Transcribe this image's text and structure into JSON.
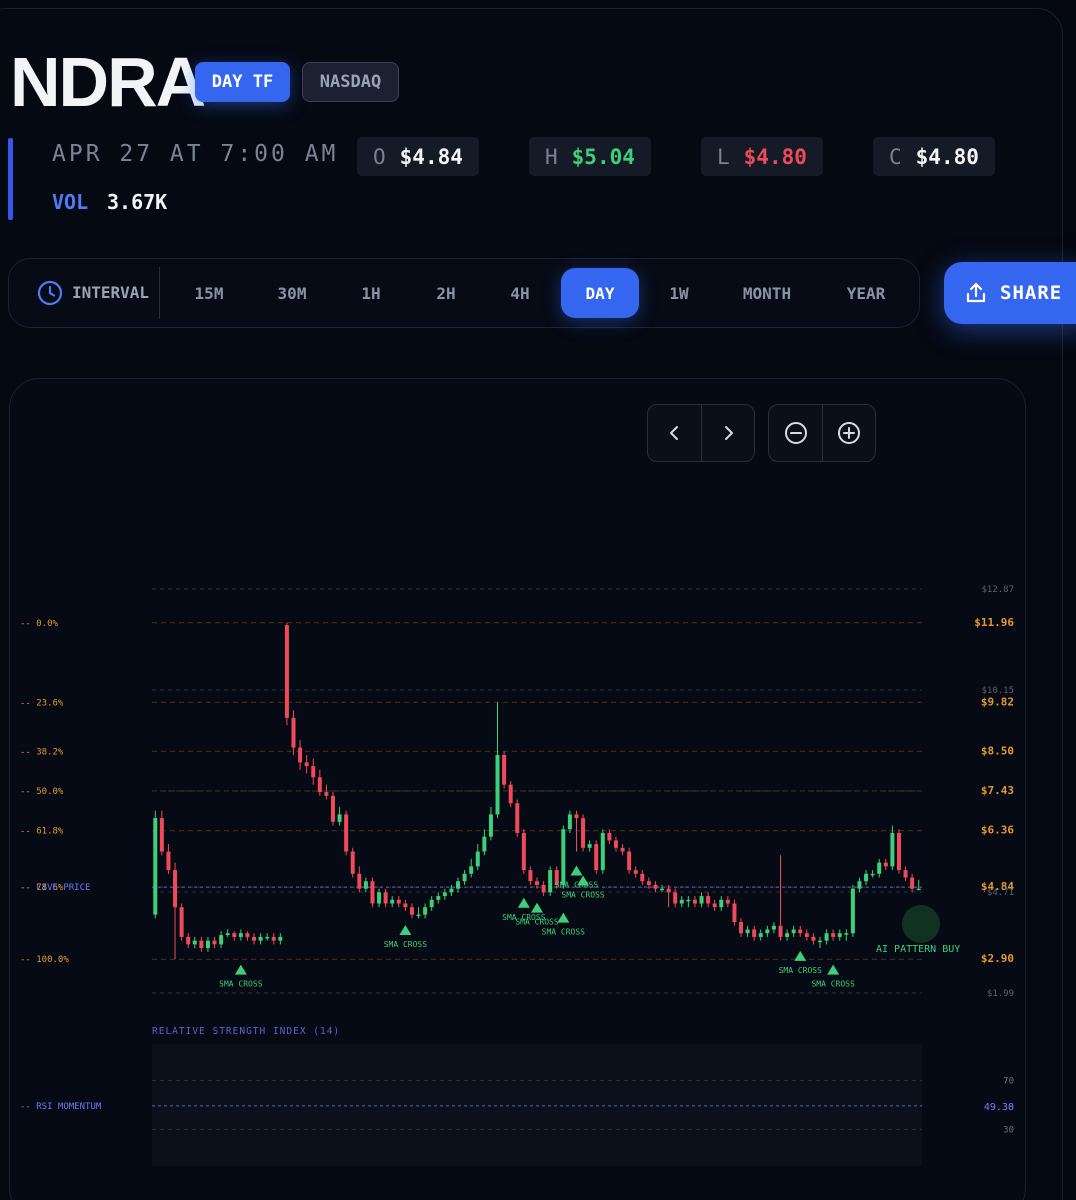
{
  "ticker": "NDRA",
  "badges": {
    "timeframe": "DAY TF",
    "exchange": "NASDAQ"
  },
  "info": {
    "date": "APR 27 AT 7:00 AM",
    "ohlc": [
      {
        "key": "O",
        "value": "$4.84",
        "color": "#f3f4f7"
      },
      {
        "key": "H",
        "value": "$5.04",
        "color": "#3ecf7b"
      },
      {
        "key": "L",
        "value": "$4.80",
        "color": "#ef4a5a"
      },
      {
        "key": "C",
        "value": "$4.80",
        "color": "#f3f4f7"
      }
    ],
    "vol_label": "VOL",
    "vol_value": "3.67K"
  },
  "interval": {
    "label": "INTERVAL",
    "options": [
      "15M",
      "30M",
      "1H",
      "2H",
      "4H",
      "DAY",
      "1W",
      "MONTH",
      "YEAR"
    ],
    "active": "DAY"
  },
  "share_label": "SHARE",
  "icons": [
    "clock-icon",
    "share-icon",
    "chevron-left-icon",
    "chevron-right-icon",
    "zoom-out-icon",
    "zoom-in-icon"
  ],
  "colors": {
    "accent": "#3466f0",
    "up": "#3ecf7b",
    "down": "#ef4a5a",
    "fib": "#e39a2a"
  },
  "chart_data": {
    "type": "candlestick",
    "price_axis_labels": [
      "$12.87",
      "$11.96",
      "$10.15",
      "$9.82",
      "$8.50",
      "$7.43",
      "$6.36",
      "$4.84",
      "$4.71",
      "$2.90",
      "$1.99"
    ],
    "price_grid": [
      12.87,
      10.15,
      7.43,
      4.71,
      1.99
    ],
    "fib_levels": [
      {
        "label": "0.0%",
        "price": 11.96,
        "price_label": "$11.96"
      },
      {
        "label": "23.6%",
        "price": 9.82,
        "price_label": "$9.82"
      },
      {
        "label": "38.2%",
        "price": 8.5,
        "price_label": "$8.50"
      },
      {
        "label": "50.0%",
        "price": 7.43,
        "price_label": "$7.43"
      },
      {
        "label": "61.8%",
        "price": 6.36,
        "price_label": "$6.36"
      },
      {
        "label": "78.6%",
        "price": 4.84,
        "price_label": "$4.84"
      },
      {
        "label": "100.0%",
        "price": 2.9,
        "price_label": "$2.90"
      }
    ],
    "live_price": {
      "label": "LIVE PRICE",
      "price": 4.84
    },
    "ylim": [
      1.99,
      12.87
    ],
    "candles": {
      "open": [
        4.1,
        6.7,
        5.8,
        5.3,
        4.3,
        3.5,
        3.3,
        3.4,
        3.2,
        3.4,
        3.3,
        3.55,
        3.6,
        3.5,
        3.6,
        3.5,
        3.4,
        3.5,
        3.5,
        3.4,
        11.9,
        9.4,
        8.6,
        8.2,
        8.1,
        7.8,
        7.4,
        7.3,
        6.6,
        6.8,
        5.8,
        5.2,
        4.8,
        5.0,
        4.4,
        4.7,
        4.4,
        4.5,
        4.4,
        4.3,
        4.1,
        4.1,
        4.3,
        4.5,
        4.6,
        4.7,
        4.8,
        5.0,
        5.2,
        5.4,
        5.8,
        6.2,
        6.8,
        8.4,
        7.6,
        7.1,
        6.3,
        5.3,
        5.0,
        4.9,
        4.7,
        5.3,
        4.9,
        6.4,
        6.8,
        6.7,
        5.9,
        6.0,
        5.3,
        6.3,
        6.1,
        5.9,
        5.8,
        5.3,
        5.2,
        5.0,
        4.9,
        4.8,
        4.8,
        4.7,
        4.4,
        4.5,
        4.5,
        4.4,
        4.6,
        4.4,
        4.3,
        4.5,
        4.4,
        3.9,
        3.6,
        3.7,
        3.5,
        3.6,
        3.7,
        3.8,
        3.5,
        3.6,
        3.7,
        3.6,
        3.5,
        3.4,
        3.4,
        3.6,
        3.5,
        3.6,
        3.6,
        4.8,
        5.0,
        5.2,
        5.2,
        5.5,
        5.4,
        6.3,
        5.3,
        5.1,
        4.8
      ],
      "close": [
        6.7,
        5.8,
        5.3,
        4.3,
        3.5,
        3.3,
        3.4,
        3.2,
        3.4,
        3.3,
        3.55,
        3.6,
        3.5,
        3.6,
        3.5,
        3.4,
        3.5,
        3.5,
        3.4,
        3.5,
        9.4,
        8.6,
        8.2,
        8.1,
        7.8,
        7.4,
        7.3,
        6.6,
        6.8,
        5.8,
        5.2,
        4.8,
        5.0,
        4.4,
        4.7,
        4.4,
        4.5,
        4.4,
        4.3,
        4.1,
        4.1,
        4.3,
        4.5,
        4.6,
        4.7,
        4.8,
        5.0,
        5.2,
        5.4,
        5.8,
        6.2,
        6.8,
        8.4,
        7.6,
        7.1,
        6.3,
        5.3,
        5.0,
        4.9,
        4.7,
        5.3,
        4.9,
        6.4,
        6.8,
        6.7,
        5.9,
        6.0,
        5.3,
        6.3,
        6.1,
        5.9,
        5.8,
        5.3,
        5.2,
        5.0,
        4.9,
        4.8,
        4.8,
        4.7,
        4.4,
        4.5,
        4.5,
        4.4,
        4.6,
        4.4,
        4.3,
        4.5,
        4.4,
        3.9,
        3.6,
        3.7,
        3.5,
        3.6,
        3.7,
        3.8,
        3.5,
        3.6,
        3.7,
        3.6,
        3.5,
        3.4,
        3.4,
        3.6,
        3.5,
        3.6,
        3.6,
        4.8,
        5.0,
        5.2,
        5.2,
        5.5,
        5.4,
        6.3,
        5.3,
        5.1,
        4.8,
        4.8
      ],
      "high": [
        6.9,
        6.9,
        6.0,
        5.5,
        4.4,
        3.6,
        3.5,
        3.5,
        3.5,
        3.5,
        3.65,
        3.7,
        3.65,
        3.7,
        3.65,
        3.6,
        3.6,
        3.6,
        3.6,
        3.6,
        11.96,
        9.6,
        8.8,
        8.4,
        8.3,
        8.0,
        7.6,
        7.4,
        7.0,
        6.9,
        5.9,
        5.4,
        5.1,
        5.1,
        4.8,
        4.8,
        4.6,
        4.6,
        4.5,
        4.4,
        4.3,
        4.4,
        4.6,
        4.7,
        4.8,
        4.9,
        5.1,
        5.3,
        5.6,
        6.0,
        6.4,
        7.0,
        9.82,
        8.5,
        7.7,
        7.2,
        6.4,
        5.4,
        5.1,
        5.0,
        5.4,
        5.4,
        6.5,
        6.9,
        6.9,
        6.8,
        6.1,
        6.1,
        6.4,
        6.4,
        6.2,
        6.0,
        5.9,
        5.4,
        5.3,
        5.1,
        5.0,
        4.9,
        4.9,
        4.8,
        4.6,
        4.6,
        4.6,
        4.7,
        4.7,
        4.5,
        4.6,
        4.6,
        4.5,
        4.0,
        3.8,
        3.8,
        3.7,
        3.8,
        3.9,
        5.7,
        3.7,
        3.8,
        3.8,
        3.7,
        3.6,
        3.5,
        3.7,
        3.7,
        3.7,
        3.7,
        4.9,
        5.1,
        5.3,
        5.3,
        5.6,
        5.6,
        6.5,
        6.4,
        5.4,
        5.2,
        5.04
      ],
      "low": [
        4.0,
        5.7,
        5.2,
        2.9,
        3.4,
        3.2,
        3.2,
        3.1,
        3.1,
        3.2,
        3.2,
        3.5,
        3.4,
        3.4,
        3.4,
        3.3,
        3.3,
        3.4,
        3.3,
        3.3,
        9.2,
        8.4,
        8.0,
        7.9,
        7.6,
        7.3,
        7.2,
        6.5,
        6.5,
        5.7,
        5.1,
        4.7,
        4.7,
        4.3,
        4.3,
        4.3,
        4.3,
        4.3,
        4.2,
        4.0,
        4.0,
        4.0,
        4.2,
        4.4,
        4.5,
        4.6,
        4.7,
        4.9,
        5.1,
        5.3,
        5.7,
        6.1,
        6.7,
        7.5,
        7.0,
        6.2,
        5.2,
        4.9,
        4.8,
        4.6,
        4.6,
        4.8,
        4.8,
        6.3,
        5.8,
        5.8,
        5.8,
        5.2,
        5.2,
        6.0,
        5.8,
        5.7,
        5.2,
        5.1,
        4.9,
        4.8,
        4.7,
        4.7,
        4.3,
        4.3,
        4.3,
        4.3,
        4.3,
        4.3,
        4.3,
        4.2,
        4.2,
        4.3,
        3.8,
        3.5,
        3.5,
        3.4,
        3.4,
        3.5,
        3.6,
        3.4,
        3.4,
        3.5,
        3.5,
        3.4,
        3.3,
        3.2,
        3.3,
        3.4,
        3.4,
        3.4,
        3.5,
        4.7,
        4.9,
        5.1,
        5.1,
        5.3,
        5.3,
        5.2,
        5.0,
        4.7,
        4.8
      ]
    },
    "sma_cross_markers": [
      {
        "label": "SMA CROSS",
        "index": 13
      },
      {
        "label": "SMA CROSS",
        "index": 38
      },
      {
        "label": "SMA CROSS",
        "index": 56
      },
      {
        "label": "SMA CROSS",
        "index": 58
      },
      {
        "label": "SMA CROSS",
        "index": 62
      },
      {
        "label": "SMA CROSS",
        "index": 64
      },
      {
        "label": "SMA CROSS",
        "index": 65
      },
      {
        "label": "SMA CROSS",
        "index": 98
      },
      {
        "label": "SMA CROSS",
        "index": 103
      }
    ],
    "ai_signal": {
      "label": "AI PATTERN BUY"
    },
    "rsi": {
      "title": "RELATIVE STRENGTH INDEX (14)",
      "label": "RSI MOMENTUM",
      "levels": [
        70,
        30
      ],
      "value_labels": [
        "49.30",
        "49.38"
      ],
      "ylim": [
        0,
        100
      ]
    }
  }
}
